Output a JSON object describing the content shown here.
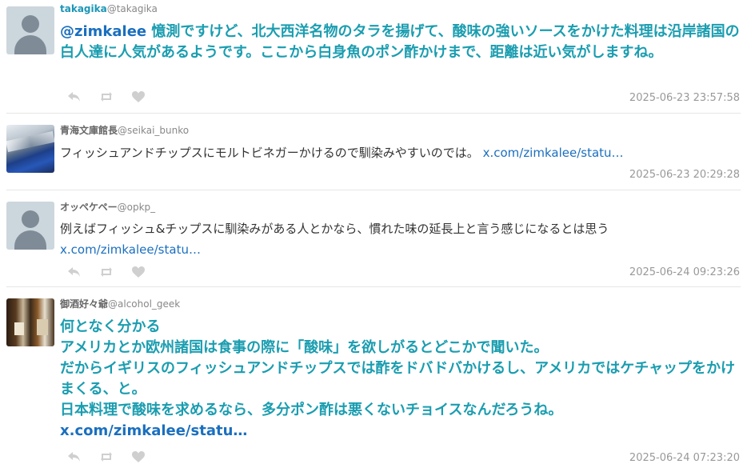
{
  "tweets": [
    {
      "name": "takagika",
      "handle": "@takagika",
      "mention": "@zimkalee",
      "text": " 憶測ですけど、北大西洋名物のタラを揚げて、酸味の強いソースをかけた料理は沿岸諸国の白人達に人気があるようです。ここから白身魚のポン酢かけまで、距離は近い気がしますね。",
      "timestamp": "2025-06-23 23:57:58"
    },
    {
      "name": "青海文庫館長",
      "handle": "@seikai_bunko",
      "text": "フィッシュアンドチップスにモルトビネガーかけるので馴染みやすいのでは。 ",
      "link": "x.com/zimkalee/statu…",
      "timestamp": "2025-06-23 20:29:28"
    },
    {
      "name": "オッペケペー",
      "handle": "@opkp_",
      "text": "例えばフィッシュ&チップスに馴染みがある人とかなら、慣れた味の延長上と言う感じになるとは思う",
      "link": "x.com/zimkalee/statu…",
      "timestamp": "2025-06-24 09:23:26"
    },
    {
      "name": "御酒好々爺",
      "handle": "@alcohol_geek",
      "text": "何となく分かる\nアメリカとか欧州諸国は食事の際に「酸味」を欲しがるとどこかで聞いた。\nだからイギリスのフィッシュアンドチップスでは酢をドバドバかけるし、アメリカではケチャップをかけまくる、と。\n日本料理で酸味を求めるなら、多分ポン酢は悪くないチョイスなんだろうね。",
      "link": "x.com/zimkalee/statu…",
      "timestamp": "2025-06-24 07:23:20"
    }
  ],
  "icons": [
    "reply-icon",
    "retweet-icon",
    "like-icon"
  ],
  "colors": {
    "accent_text": "#1a9db0",
    "link": "#1a6fbf",
    "timestamp": "#999999",
    "icon": "#cfcfcf"
  }
}
